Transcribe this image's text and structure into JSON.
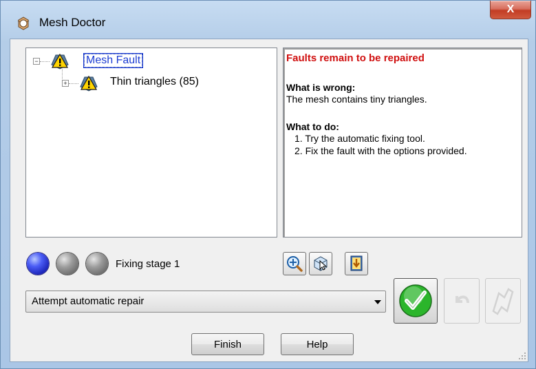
{
  "window": {
    "title": "Mesh Doctor",
    "close_label": "X"
  },
  "tree": {
    "root": {
      "label": "Mesh Fault",
      "icon": "warning-icon"
    },
    "children": [
      {
        "label": "Thin triangles (85)",
        "icon": "warning-icon"
      }
    ]
  },
  "info": {
    "status": "Faults remain to be repaired",
    "wrong_heading": "What is wrong:",
    "wrong_text": "The mesh contains tiny triangles.",
    "todo_heading": "What to do:",
    "todo_items": [
      "1. Try the automatic fixing tool.",
      "2. Fix the fault with the options provided."
    ]
  },
  "stage": {
    "label": "Fixing stage 1",
    "dots": [
      "active",
      "inactive",
      "inactive"
    ]
  },
  "tools": {
    "icons": [
      "zoom-icon",
      "view-select-icon",
      "export-icon"
    ]
  },
  "repair": {
    "selected_option": "Attempt automatic repair"
  },
  "buttons": {
    "finish": "Finish",
    "help": "Help"
  },
  "colors": {
    "status_red": "#d01010",
    "selection_blue": "#1c3dd3",
    "stage_active": "#2a34d8",
    "apply_green": "#2bb52b"
  }
}
